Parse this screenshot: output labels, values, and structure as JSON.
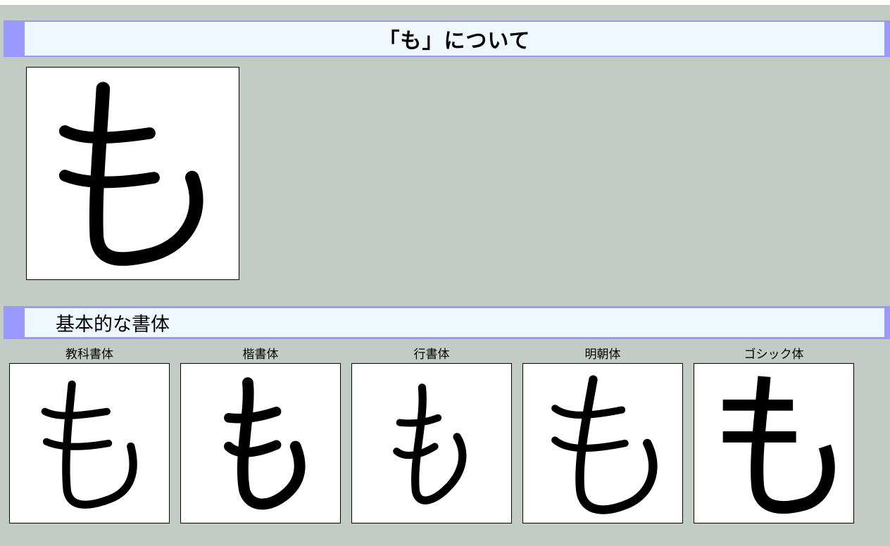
{
  "page": {
    "title": "「も」について",
    "character": "も"
  },
  "section": {
    "title": "基本的な書体"
  },
  "font_styles": [
    {
      "label": "教科書体"
    },
    {
      "label": "楷書体"
    },
    {
      "label": "行書体"
    },
    {
      "label": "明朝体"
    },
    {
      "label": "ゴシック体"
    }
  ],
  "colors": {
    "page_background": "#c2ccc4",
    "heading_accent": "#9999ff",
    "heading_background": "#f0f8ff"
  }
}
